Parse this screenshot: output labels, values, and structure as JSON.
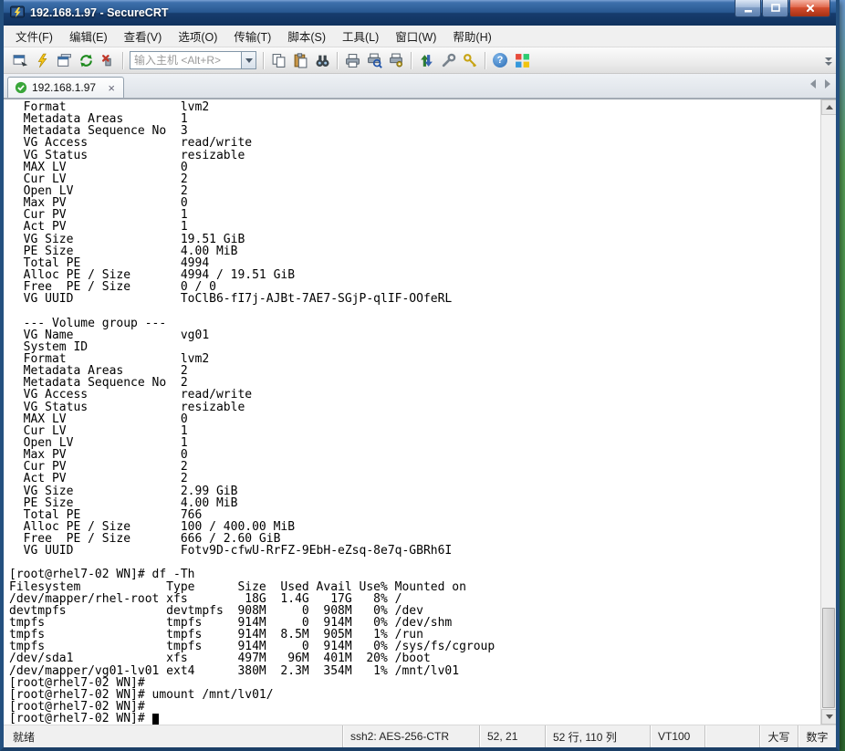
{
  "window": {
    "title": "192.168.1.97 - SecureCRT"
  },
  "menu": {
    "items": [
      "文件(F)",
      "编辑(E)",
      "查看(V)",
      "选项(O)",
      "传输(T)",
      "脚本(S)",
      "工具(L)",
      "窗口(W)",
      "帮助(H)"
    ]
  },
  "toolbar": {
    "host_placeholder": "输入主机 <Alt+R>",
    "help_glyph": "?",
    "icons": [
      "connect-icon",
      "quick-connect-icon",
      "connect-in-tab-icon",
      "reconnect-icon",
      "disconnect-icon",
      "copy-icon",
      "paste-icon",
      "find-icon",
      "print-icon",
      "print-preview-icon",
      "print-setup-icon",
      "file-transfer-icon",
      "session-options-icon",
      "key-icon",
      "help-icon",
      "script-grid-icon"
    ]
  },
  "tabbar": {
    "active_tab": "192.168.1.97",
    "close_glyph": "×"
  },
  "terminal": {
    "fg": "#000000",
    "bg": "#ffffff",
    "lines": [
      "  Format                lvm2",
      "  Metadata Areas        1",
      "  Metadata Sequence No  3",
      "  VG Access             read/write",
      "  VG Status             resizable",
      "  MAX LV                0",
      "  Cur LV                2",
      "  Open LV               2",
      "  Max PV                0",
      "  Cur PV                1",
      "  Act PV                1",
      "  VG Size               19.51 GiB",
      "  PE Size               4.00 MiB",
      "  Total PE              4994",
      "  Alloc PE / Size       4994 / 19.51 GiB",
      "  Free  PE / Size       0 / 0",
      "  VG UUID               ToClB6-fI7j-AJBt-7AE7-SGjP-qlIF-OOfeRL",
      "",
      "  --- Volume group ---",
      "  VG Name               vg01",
      "  System ID",
      "  Format                lvm2",
      "  Metadata Areas        2",
      "  Metadata Sequence No  2",
      "  VG Access             read/write",
      "  VG Status             resizable",
      "  MAX LV                0",
      "  Cur LV                1",
      "  Open LV               1",
      "  Max PV                0",
      "  Cur PV                2",
      "  Act PV                2",
      "  VG Size               2.99 GiB",
      "  PE Size               4.00 MiB",
      "  Total PE              766",
      "  Alloc PE / Size       100 / 400.00 MiB",
      "  Free  PE / Size       666 / 2.60 GiB",
      "  VG UUID               Fotv9D-cfwU-RrFZ-9EbH-eZsq-8e7q-GBRh6I",
      "",
      "[root@rhel7-02 WN]# df -Th",
      "Filesystem            Type      Size  Used Avail Use% Mounted on",
      "/dev/mapper/rhel-root xfs        18G  1.4G   17G   8% /",
      "devtmpfs              devtmpfs  908M     0  908M   0% /dev",
      "tmpfs                 tmpfs     914M     0  914M   0% /dev/shm",
      "tmpfs                 tmpfs     914M  8.5M  905M   1% /run",
      "tmpfs                 tmpfs     914M     0  914M   0% /sys/fs/cgroup",
      "/dev/sda1             xfs       497M   96M  401M  20% /boot",
      "/dev/mapper/vg01-lv01 ext4      380M  2.3M  354M   1% /mnt/lv01",
      "[root@rhel7-02 WN]# ",
      "[root@rhel7-02 WN]# umount /mnt/lv01/",
      "[root@rhel7-02 WN]# ",
      "[root@rhel7-02 WN]# "
    ]
  },
  "statusbar": {
    "ready": "就绪",
    "cipher": "ssh2: AES-256-CTR",
    "cursor_pos": "52, 21",
    "screen_size": "52 行, 110 列",
    "emulation": "VT100",
    "caps_label": "大写",
    "num_label": "数字"
  },
  "colors": {
    "titlebar_blue": "#285891",
    "close_red": "#d44e2e",
    "tab_check_green": "#3aa63a",
    "terminal_bg": "#ffffff",
    "terminal_fg": "#000000"
  }
}
